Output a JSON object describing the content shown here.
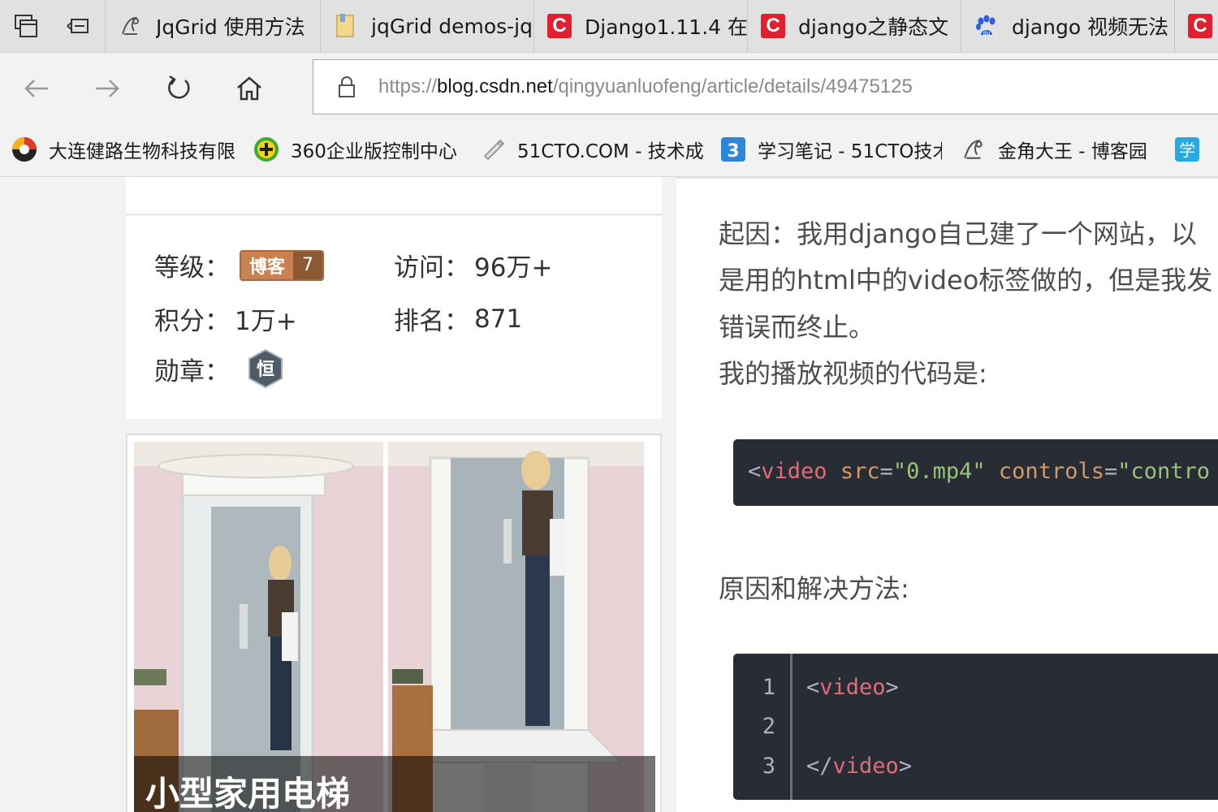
{
  "tabs": [
    {
      "title": "JqGrid 使用方法",
      "icon": "cnblogs-icon"
    },
    {
      "title": "jqGrid demos-jq",
      "icon": "folder-icon"
    },
    {
      "title": "Django1.11.4 在",
      "icon": "csdn-icon"
    },
    {
      "title": "django之静态文",
      "icon": "csdn-icon"
    },
    {
      "title": "django 视频无法",
      "icon": "baidu-paw-icon"
    }
  ],
  "address": {
    "scheme": "https://",
    "host": "blog.csdn.net",
    "path": "/qingyuanluofeng/article/details/49475125"
  },
  "favorites": [
    {
      "label": "大连健路生物科技有限",
      "icon": "ring-logo-icon"
    },
    {
      "label": "360企业版控制中心",
      "icon": "plus-circle-icon"
    },
    {
      "label": "51CTO.COM - 技术成",
      "icon": "pen-icon"
    },
    {
      "label": "学习笔记 - 51CTO技术",
      "icon": "number-3-icon"
    },
    {
      "label": "金角大王 - 博客园",
      "icon": "cnblogs-icon"
    },
    {
      "label": "学",
      "icon": "study-icon"
    }
  ],
  "stats": {
    "level_label": "等级：",
    "level_badge": "博客",
    "level_num": "7",
    "visits_label": "访问：",
    "visits_value": "96万+",
    "points_label": "积分：",
    "points_value": "1万+",
    "rank_label": "排名：",
    "rank_value": "871",
    "medal_label": "勋章：",
    "medal_char": "恒"
  },
  "ad": {
    "title": "小型家用电梯"
  },
  "article": {
    "para1": "起因：我用django自己建了一个网站，以",
    "para2": "是用的html中的video标签做的，但是我发",
    "para3": "错误而终止。",
    "para4": "我的播放视频的代码是:",
    "code1": {
      "open": "<",
      "tag": "video",
      "attr1": "src",
      "eq1": "=",
      "val1": "\"0.mp4\"",
      "attr2": "controls",
      "eq2": "=",
      "val2": "\"contro"
    },
    "heading": "原因和解决方法:",
    "code2": {
      "line_numbers": [
        "1",
        "2",
        "3"
      ],
      "l1_open": "<",
      "l1_tag": "video",
      "l1_close": ">",
      "l3_open": "</",
      "l3_tag": "video",
      "l3_close": ">"
    }
  }
}
